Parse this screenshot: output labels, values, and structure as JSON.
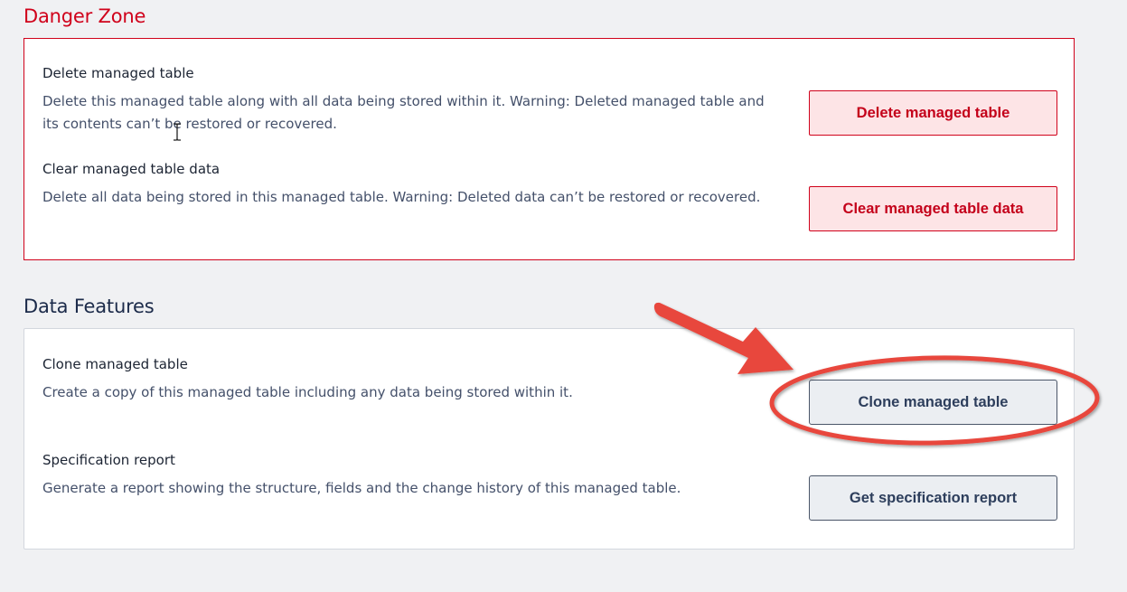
{
  "danger_zone": {
    "title": "Danger Zone",
    "items": [
      {
        "title": "Delete managed table",
        "description": "Delete this managed table along with all data being stored within it. Warning: Deleted managed table and its contents can’t be restored or recovered.",
        "button": "Delete managed table"
      },
      {
        "title": "Clear managed table data",
        "description": "Delete all data being stored in this managed table. Warning: Deleted data can’t be restored or recovered.",
        "button": "Clear managed table data"
      }
    ]
  },
  "data_features": {
    "title": "Data Features",
    "items": [
      {
        "title": "Clone managed table",
        "description": "Create a copy of this managed table including any data being stored within it.",
        "button": "Clone managed table"
      },
      {
        "title": "Specification report",
        "description": "Generate a report showing the structure, fields and the change history of this managed table.",
        "button": "Get specification report"
      }
    ]
  },
  "colors": {
    "danger": "#d0021b",
    "danger_bg": "#fde4e6",
    "page_bg": "#f0f1f3",
    "annotation": "#e8463c"
  },
  "annotation": {
    "shapes": [
      "arrow-icon",
      "ellipse-highlight"
    ]
  }
}
